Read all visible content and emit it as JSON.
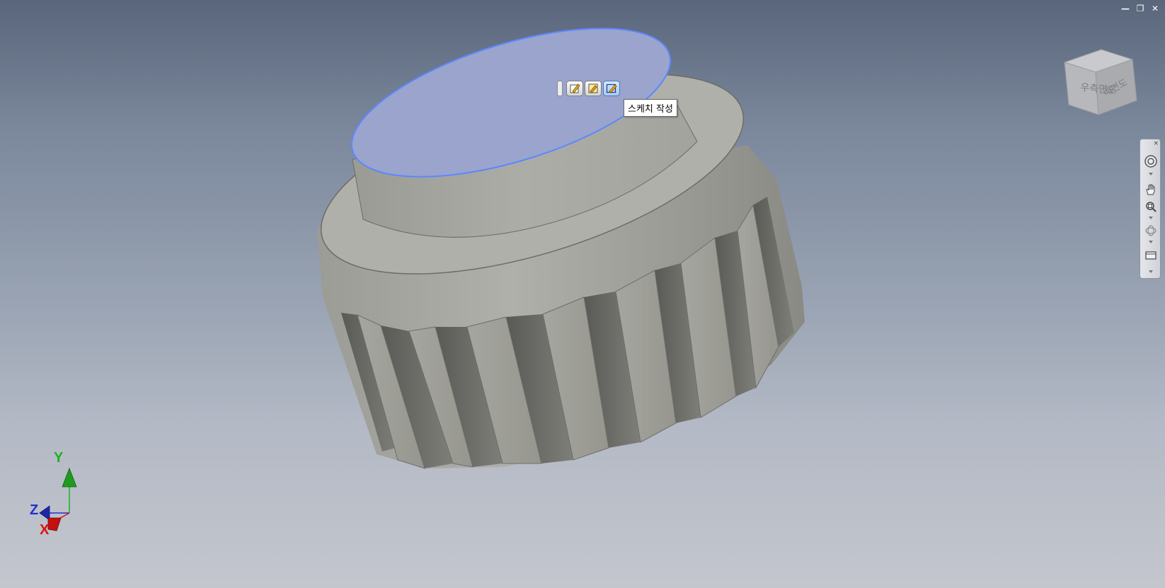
{
  "window": {
    "minimize_glyph": "—",
    "restore_glyph": "❐",
    "close_glyph": "✕"
  },
  "mini_toolbar": {
    "buttons": [
      {
        "icon": "edit-sketch-icon"
      },
      {
        "icon": "edit-feature-icon"
      },
      {
        "icon": "create-sketch-icon"
      }
    ]
  },
  "tooltip": {
    "text": "스케치 작성"
  },
  "viewcube": {
    "face_left": "우측면도",
    "face_right": "배면도"
  },
  "navigation_bar": {
    "close_glyph": "×",
    "items": [
      {
        "icon": "steering-wheel-icon"
      },
      {
        "icon": "pan-icon"
      },
      {
        "icon": "zoom-icon"
      },
      {
        "icon": "orbit-icon"
      },
      {
        "icon": "look-at-icon"
      }
    ]
  },
  "triad": {
    "x_label": "X",
    "y_label": "Y",
    "z_label": "Z"
  },
  "colors": {
    "face_highlight": "#9aa4cc",
    "highlight_edge": "#5b87ff",
    "model_gray": "#a0a09a",
    "axis_x": "#e01010",
    "axis_y": "#20b020",
    "axis_z": "#2030d0"
  }
}
